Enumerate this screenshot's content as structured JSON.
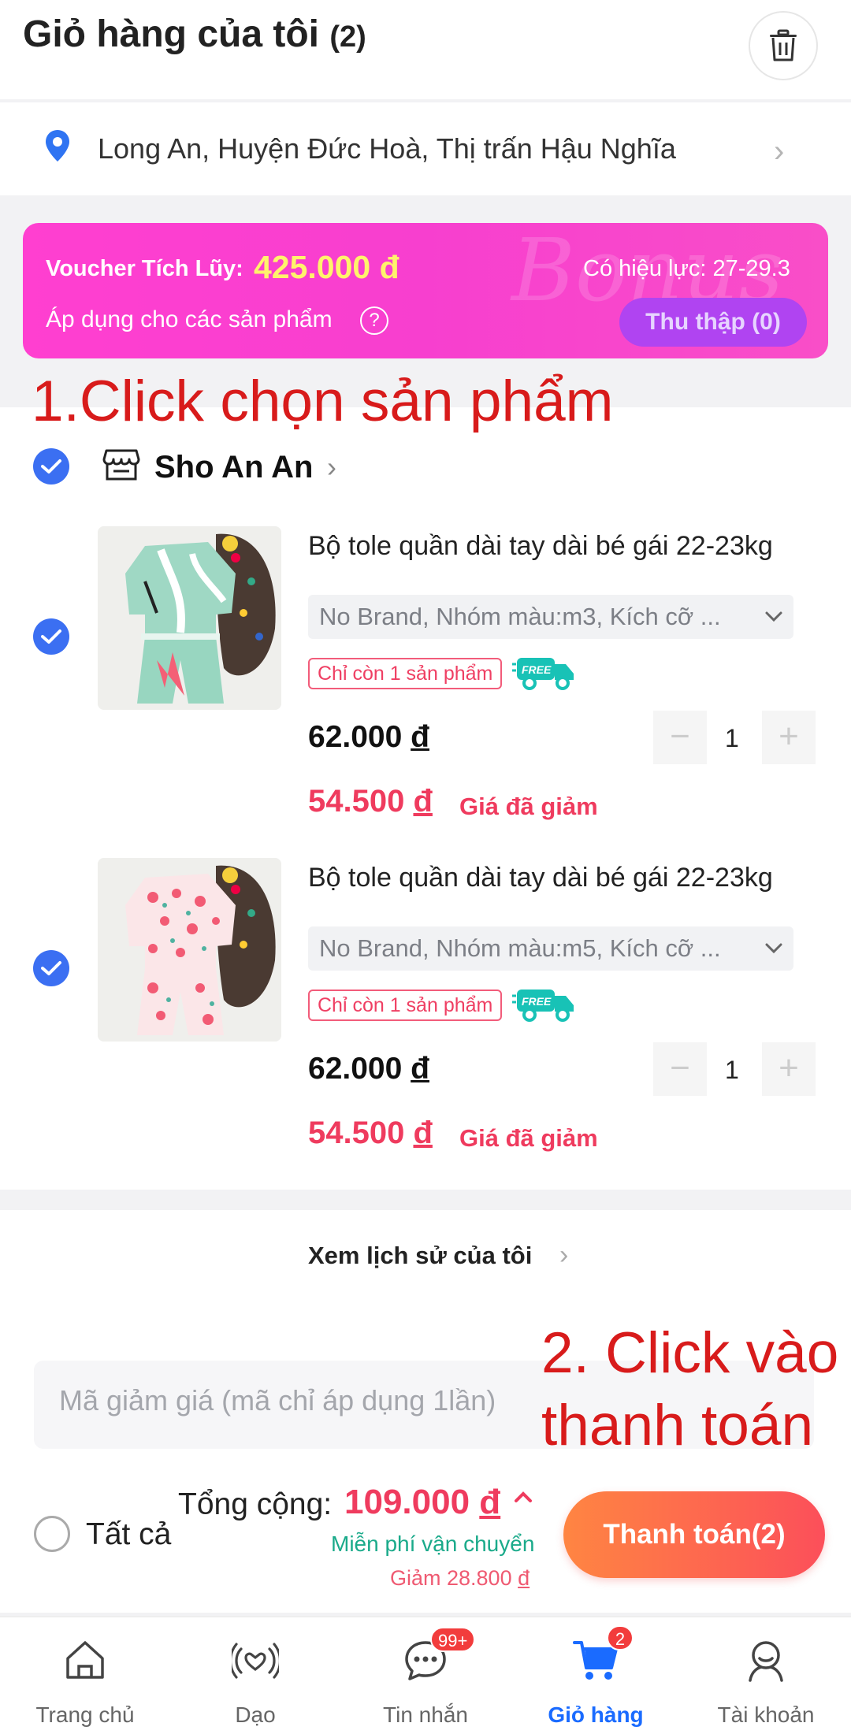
{
  "header": {
    "title": "Giỏ hàng của tôi",
    "count": "(2)"
  },
  "address": {
    "text": "Long An, Huyện Đức Hoà, Thị trấn Hậu Nghĩa"
  },
  "voucher": {
    "label": "Voucher Tích Lũy:",
    "amount": "425.000 đ",
    "validity": "Có hiệu lực: 27-29.3",
    "apply_text": "Áp dụng cho các sản phẩm",
    "collect_label": "Thu thập (0)",
    "watermark": "Bonus"
  },
  "annotations": {
    "step1": "1.Click chọn sản phẩm",
    "step2_line1": "2. Click vào",
    "step2_line2": "thanh toán"
  },
  "shop": {
    "name": "Sho An An"
  },
  "items": [
    {
      "name": "Bộ tole quần dài tay dài bé gái 22-23kg",
      "variant": "No Brand, Nhóm màu:m3, Kích cỡ ...",
      "stock_tag": "Chỉ còn 1 sản phẩm",
      "price_num": "62.000",
      "sale_num": "54.500",
      "sale_label": "Giá đã giảm",
      "quantity": "1"
    },
    {
      "name": "Bộ tole quần dài tay dài bé gái 22-23kg",
      "variant": "No Brand, Nhóm màu:m5, Kích cỡ ...",
      "stock_tag": "Chỉ còn 1 sản phẩm",
      "price_num": "62.000",
      "sale_num": "54.500",
      "sale_label": "Giá đã giảm",
      "quantity": "1"
    }
  ],
  "currency": "đ",
  "history": {
    "label": "Xem lịch sử của tôi"
  },
  "coupon": {
    "placeholder": "Mã giảm giá (mã chỉ áp dụng 1lần)"
  },
  "footer": {
    "select_all": "Tất cả",
    "total_label": "Tổng cộng:",
    "total_num": "109.000",
    "shipping": "Miễn phí vận chuyển",
    "discount_prefix": "Giảm 28.800",
    "pay_label": "Thanh toán(2)"
  },
  "tabs": [
    {
      "label": "Trang chủ"
    },
    {
      "label": "Dạo"
    },
    {
      "label": "Tin nhắn",
      "badge": "99+"
    },
    {
      "label": "Giỏ hàng",
      "badge": "2"
    },
    {
      "label": "Tài khoản"
    }
  ],
  "colors": {
    "accent": "#3b6ff2",
    "price_red": "#ef3b5e",
    "voucher_pink": "#ff3fd0",
    "pay_orange": "#ff8542",
    "tab_active": "#1a6bff"
  }
}
